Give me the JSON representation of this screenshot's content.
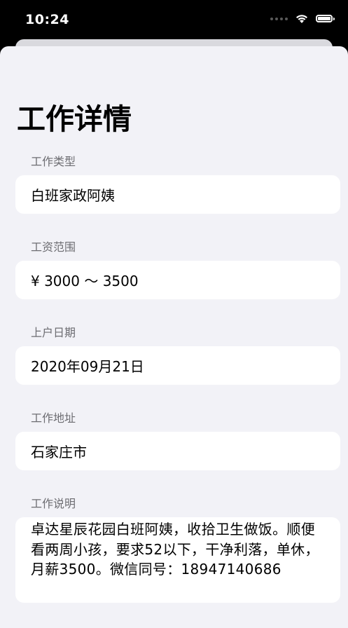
{
  "status_bar": {
    "time": "10:24"
  },
  "page": {
    "title": "工作详情"
  },
  "fields": [
    {
      "label": "工作类型",
      "value": "白班家政阿姨"
    },
    {
      "label": "工资范围",
      "value": "¥ 3000 ～ 3500"
    },
    {
      "label": "上户日期",
      "value": "2020年09月21日"
    },
    {
      "label": "工作地址",
      "value": "石家庄市"
    },
    {
      "label": "工作说明",
      "value": "卓达星辰花园白班阿姨，收拾卫生做饭。顺便看两周小孩，要求52以下，干净利落，单休，月薪3500。微信同号：18947140686"
    }
  ],
  "colors": {
    "background": "#f2f2f7",
    "card": "#ffffff",
    "label": "#6d6d72",
    "status_bar": "#000000"
  }
}
